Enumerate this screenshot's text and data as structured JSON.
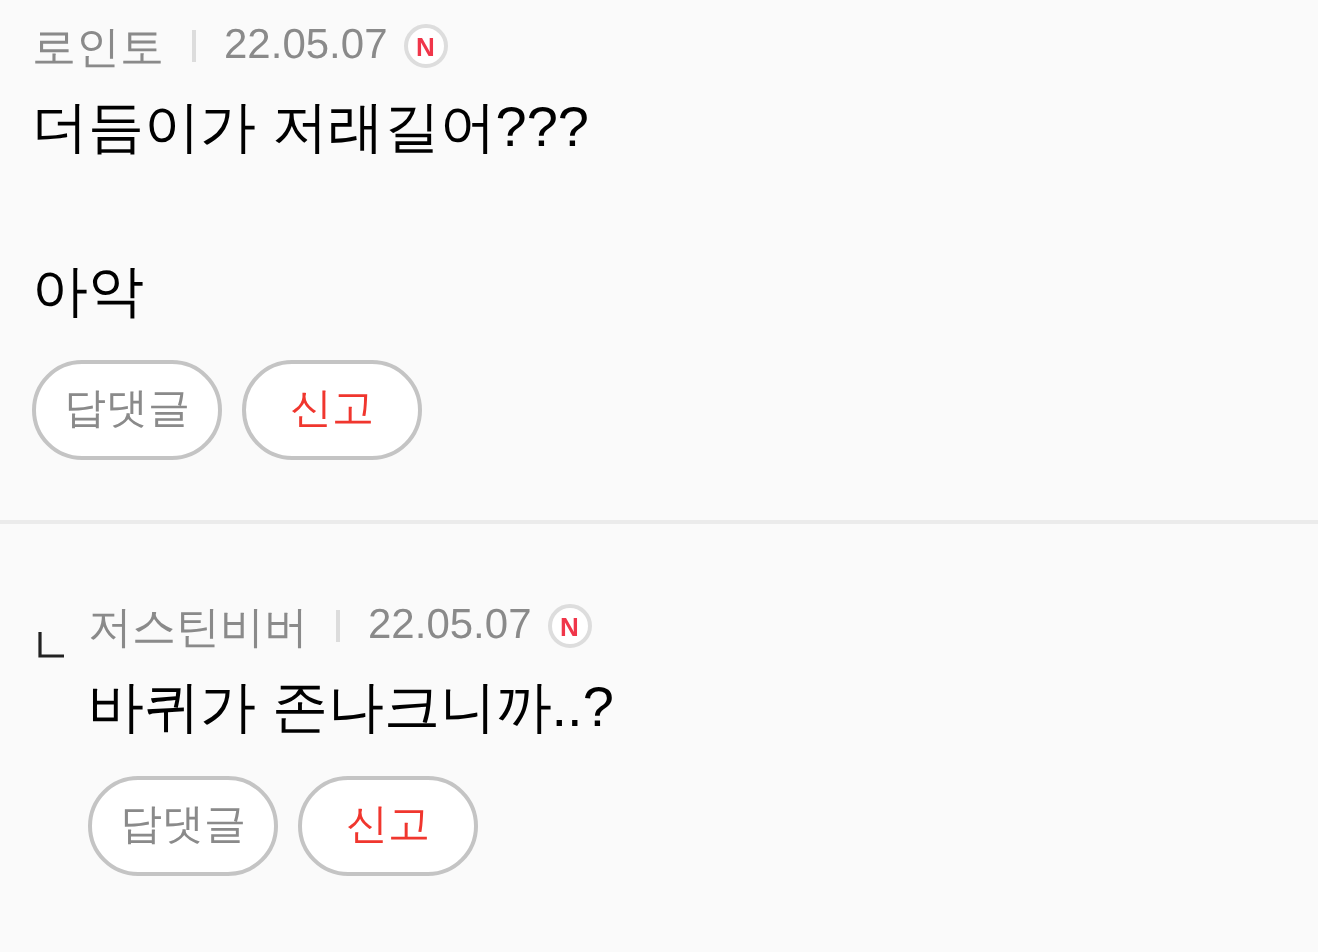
{
  "comments": [
    {
      "kind": "comment",
      "author": "로인토",
      "date": "22.05.07",
      "badge": "N",
      "paragraphs": [
        "더듬이가 저래길어???",
        "아악"
      ],
      "buttons": [
        {
          "label": "답댓글",
          "kind": "reply"
        },
        {
          "label": "신고",
          "kind": "report"
        }
      ]
    },
    {
      "kind": "reply",
      "author": "저스틴비버",
      "date": "22.05.07",
      "badge": "N",
      "paragraphs": [
        "바퀴가 존나크니까..?"
      ],
      "buttons": [
        {
          "label": "답댓글",
          "kind": "reply"
        },
        {
          "label": "신고",
          "kind": "report"
        }
      ]
    }
  ]
}
